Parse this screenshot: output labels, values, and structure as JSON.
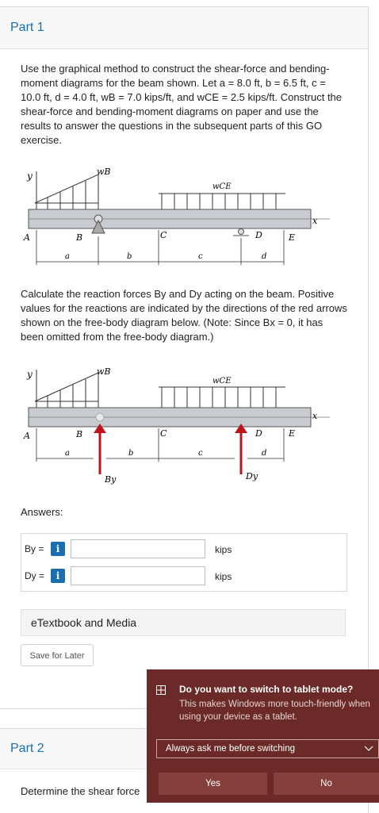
{
  "part1": {
    "title": "Part 1",
    "problem_text": "Use the graphical method to construct the shear-force and bending-moment diagrams for the beam shown. Let a = 8.0 ft, b = 6.5 ft, c = 10.0 ft, d = 4.0 ft, wB = 7.0 kips/ft, and wCE = 2.5 kips/ft. Construct the shear-force and bending-moment diagrams on paper and use the results to answer the questions in the subsequent parts of this GO exercise.",
    "reactions_text": "Calculate the reaction forces By and Dy acting on the beam. Positive values for the reactions are indicated by the directions of the red arrows shown on the free-body diagram below. (Note: Since Bx = 0, it has been omitted from the free-body diagram.)",
    "figure1": {
      "y": "y",
      "x": "x",
      "wB": "wB",
      "wCE": "wCE",
      "A": "A",
      "B": "B",
      "C": "C",
      "D": "D",
      "E": "E",
      "a": "a",
      "b": "b",
      "c": "c",
      "d": "d"
    },
    "figure2": {
      "y": "y",
      "x": "x",
      "wB": "wB",
      "wCE": "wCE",
      "A": "A",
      "B": "B",
      "C": "C",
      "D": "D",
      "E": "E",
      "a": "a",
      "b": "b",
      "c": "c",
      "d": "d",
      "By": "By",
      "Dy": "Dy"
    },
    "answers_label": "Answers:",
    "answers": [
      {
        "label": "By =",
        "info": "i",
        "value": "",
        "unit": "kips"
      },
      {
        "label": "Dy =",
        "info": "i",
        "value": "",
        "unit": "kips"
      }
    ],
    "etextbook": "eTextbook and Media",
    "save_later": "Save for Later"
  },
  "part2": {
    "title": "Part 2",
    "text": "Determine the shear force"
  },
  "toast": {
    "title": "Do you want to switch to tablet mode?",
    "body": "This makes Windows more touch-friendly when using your device as a tablet.",
    "select": "Always ask me before switching",
    "yes": "Yes",
    "no": "No"
  },
  "colors": {
    "accent": "#1a6fb3",
    "toast_bg": "#6b2a27",
    "reaction_arrow": "#c0141c"
  }
}
